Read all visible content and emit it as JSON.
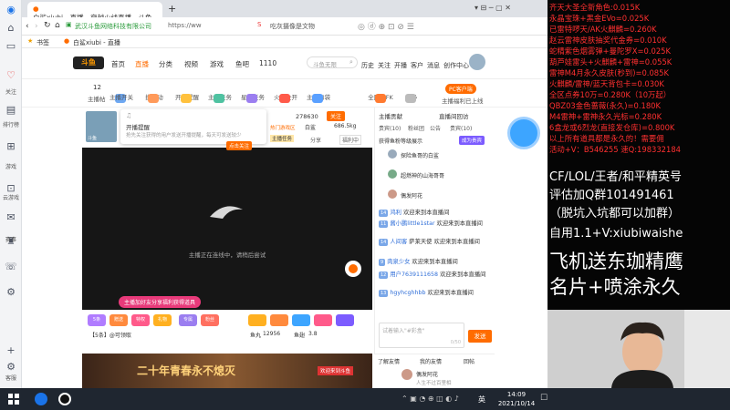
{
  "left_rail": {
    "items": [
      {
        "label": "关注",
        "icon": "heart-icon"
      },
      {
        "label": "排行榜",
        "icon": "book-icon"
      },
      {
        "label": "游戏",
        "icon": "gamepad-icon"
      },
      {
        "label": "云游戏",
        "icon": "cart-icon"
      },
      {
        "label": "赛事",
        "icon": "trophy-icon"
      },
      {
        "label": "客服",
        "icon": "message-icon"
      }
    ]
  },
  "browser": {
    "tab_title": "白鲨xiubi - 直播 - 穿越火线直播 - 斗鱼",
    "new_tab": "+",
    "company": "武汉斗鱼网络科技有限公司",
    "url": "https://ww",
    "search_hint": "吃灰摄像是文物",
    "bookmark_label": "书签",
    "bookmark_site": "白鲨xiubi - 直播"
  },
  "site": {
    "logo": "斗鱼",
    "nav": [
      "首页",
      "直播",
      "分类",
      "视频",
      "游戏",
      "鱼吧",
      "1110"
    ],
    "search_placeholder": "斗鱼无限",
    "header_actions": [
      "历史",
      "关注",
      "开播",
      "客户",
      "消息",
      "创作中心"
    ]
  },
  "subnav": {
    "badge_count": "12",
    "first_label": "主播帖",
    "items": [
      "主播开关",
      "摸活动",
      "开播提醒",
      "主播任务",
      "星海任务",
      "火力全开",
      "主播口袋",
      "全民斗FK",
      "更多"
    ],
    "right_tag": "PC客户端",
    "right_label": "主播福利已上线"
  },
  "room": {
    "notice_title": "开播提醒",
    "notice_text": "抢先关注获得的用户发送开播提醒，每天可发送较少",
    "follow_prompt": "点击关注",
    "badge1": "热门游戏区",
    "badge2": "火力全开",
    "tag_badge": "主播任务",
    "hot_label": "热门",
    "fans_value": "278630",
    "follow_label": "关注",
    "category": "白鲨",
    "weight": "686.5kg",
    "share_label": "分享",
    "report_label": "福利中",
    "player_status": "主播正在连线中，请稍后尝试",
    "avatar_name": "斗鱼"
  },
  "gift_bar": {
    "promo": "主播加好友分享福利获得道具",
    "labels": [
      "5条",
      "赠送",
      "特权",
      "礼物",
      "专属",
      "粉丝"
    ],
    "fish_label": "鱼丸",
    "fish_value": "12956",
    "fish2_label": "鱼翅",
    "fish2_value": "3.8",
    "task_label": "【5条】@可领取"
  },
  "banner": {
    "title": "二十年青春永不熄灭",
    "tag": "欢迎来到斗鱼"
  },
  "chat": {
    "tabs": [
      "主播贡献",
      "直播间回访"
    ],
    "sub_tabs": [
      "贵宾(10)",
      "粉丝团",
      "公告",
      "贵宾(10)"
    ],
    "rank_header": "获得鱼粉等级展示",
    "rank_badge": "成为贵宾",
    "rank_users": [
      "探险鱼哥的白鲨",
      "超燃神的山海哥哥",
      "偶发阿花"
    ],
    "messages": [
      {
        "lvl": "14",
        "user": "鸿利",
        "text": "欢迎来到本直播间"
      },
      {
        "lvl": "11",
        "user": "酱小鹏little1star",
        "text": "欢迎来到本直播间"
      },
      {
        "lvl": "14",
        "user": "人间客",
        "text": "萨莱天使",
        "extra": "欢迎来到本直播间"
      },
      {
        "lvl": "9",
        "user": "肉泉少女",
        "text": "欢迎来到本直播间"
      },
      {
        "lvl": "12",
        "user": "用户7639111658",
        "text": "欢迎来到本直播间"
      },
      {
        "lvl": "13",
        "user": "hgyhcghhbb",
        "text": "欢迎来到本直播间"
      }
    ],
    "input_placeholder": "试着输入\"#彩盒\"",
    "send_label": "发送",
    "input_count": "0/50"
  },
  "fans_panel": {
    "header": "了解友情",
    "tabs": [
      "我的友情",
      "回帖"
    ],
    "user": "偶发阿花",
    "sub": "人生不过百里相"
  },
  "overlay": {
    "lines": [
      {
        "text": "齐天大圣全新角色:0.015K",
        "color": "#ff3030"
      },
      {
        "text": "永晶宝珠+黑金EVo=0.025K",
        "color": "#ff3030"
      },
      {
        "text": "已雷特啰天/AK火麒麟=0.260K",
        "color": "#ff3030"
      },
      {
        "text": "赵云雷神皮肤抽奖代金券=0.010K",
        "color": "#ff3030"
      },
      {
        "text": "蛇精紫色烟雾弹+曼陀罗X=0.025K",
        "color": "#ff3030"
      },
      {
        "text": "葫芦娃雷头+火麒麟+雷神=0.055K",
        "color": "#ff3030"
      },
      {
        "text": "雷神M4月永久皮肤(秒到)=0.085K",
        "color": "#ff3030"
      },
      {
        "text": "火麒麟/雷神/蓝天背包卡=0.030K",
        "color": "#ff3030"
      },
      {
        "text": "全区点券10万=0.280K（10万起）",
        "color": "#ff3030"
      },
      {
        "text": "QBZ03金色蔷薇(永久)=0.180K",
        "color": "#ff3030"
      },
      {
        "text": "M4雷神+雷神永久光标=0.280K",
        "color": "#ff3030"
      },
      {
        "text": "6盒龙或6烈龙(直接发仓库)=0.800K",
        "color": "#ff3030"
      },
      {
        "text": "以上所有道具都是永久的！需要佣",
        "color": "#ff3030"
      },
      {
        "text": "活动+V：B546255  速Q:198332184",
        "color": "#ff3030"
      }
    ],
    "big_lines": [
      {
        "text": "CF/LOL/王者/和平精英号",
        "color": "#ffffff"
      },
      {
        "text": "评估加Q群101491461",
        "color": "#ffffff"
      },
      {
        "text": "（脱坑入坑都可以加群）",
        "color": "#ffffff"
      },
      {
        "text": "自用1.1+V:xiubiwaishe",
        "color": "#ffffff"
      }
    ],
    "promo_lines": [
      "飞机送东珈精鹰",
      "名片+喷涂永久"
    ]
  },
  "taskbar": {
    "time": "14:09",
    "date": "2021/10/14",
    "lang": "英"
  },
  "colors": {
    "brand_orange": "#ff6c00",
    "brand_blue": "#2f6ed8",
    "overlay_red": "#ff3030"
  }
}
